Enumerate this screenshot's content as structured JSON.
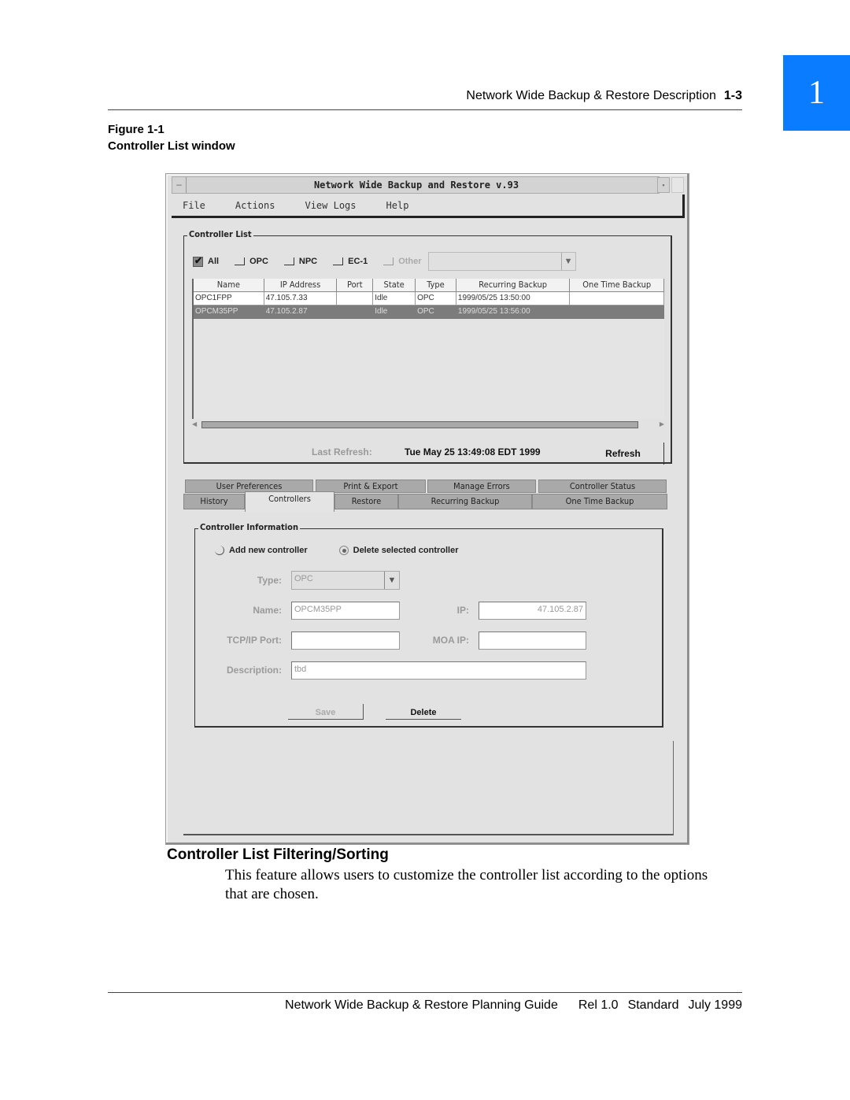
{
  "page": {
    "running_header": "Network Wide Backup & Restore Description",
    "page_number": "1-3",
    "chapter_tab": "1",
    "figure_number": "Figure 1-1",
    "figure_caption": "Controller List window",
    "section_heading": "Controller List Filtering/Sorting",
    "section_body": "This feature allows users to customize the controller list according to the options that are chosen.",
    "footer": {
      "guide_title": "Network Wide Backup & Restore Planning Guide",
      "release": "Rel 1.0",
      "status": "Standard",
      "date": "July 1999"
    },
    "colors": {
      "chapter_tab": "#0a7cff"
    }
  },
  "window": {
    "title": "Network Wide Backup and Restore v.93",
    "menu": [
      "File",
      "Actions",
      "View Logs",
      "Help"
    ],
    "controller_list": {
      "legend": "Controller List",
      "filters": [
        {
          "label": "All",
          "checked": true,
          "enabled": true
        },
        {
          "label": "OPC",
          "checked": false,
          "enabled": true
        },
        {
          "label": "NPC",
          "checked": false,
          "enabled": true
        },
        {
          "label": "EC-1",
          "checked": false,
          "enabled": true
        },
        {
          "label": "Other",
          "checked": false,
          "enabled": false
        }
      ],
      "other_value": "",
      "columns": [
        "Name",
        "IP Address",
        "Port",
        "State",
        "Type",
        "Recurring Backup",
        "One Time Backup"
      ],
      "rows": [
        {
          "cells": [
            "OPC1FPP",
            "47.105.7.33",
            "",
            "Idle",
            "OPC",
            "1999/05/25 13:50:00",
            ""
          ],
          "selected": false
        },
        {
          "cells": [
            "OPCM35PP",
            "47.105.2.87",
            "",
            "Idle",
            "OPC",
            "1999/05/25 13:56:00",
            ""
          ],
          "selected": true
        }
      ],
      "last_refresh_label": "Last Refresh:",
      "last_refresh_value": "Tue May 25 13:49:08 EDT 1999",
      "refresh_button": "Refresh"
    },
    "tabs": {
      "row1": [
        "User Preferences",
        "Print & Export",
        "Manage Errors",
        "Controller Status"
      ],
      "row2": [
        "History",
        "Controllers",
        "Restore",
        "Recurring Backup",
        "One Time Backup"
      ],
      "active": "Controllers"
    },
    "controller_info": {
      "legend": "Controller Information",
      "radio_add": "Add new controller",
      "radio_delete": "Delete selected controller",
      "selected_mode": "delete",
      "type_label": "Type:",
      "type_value": "OPC",
      "name_label": "Name:",
      "name_value": "OPCM35PP",
      "ip_label": "IP:",
      "ip_value": "47.105.2.87",
      "port_label": "TCP/IP Port:",
      "port_value": "",
      "moa_ip_label": "MOA IP:",
      "moa_ip_value": "",
      "description_label": "Description:",
      "description_value": "tbd",
      "save_button": "Save",
      "delete_button": "Delete"
    }
  }
}
